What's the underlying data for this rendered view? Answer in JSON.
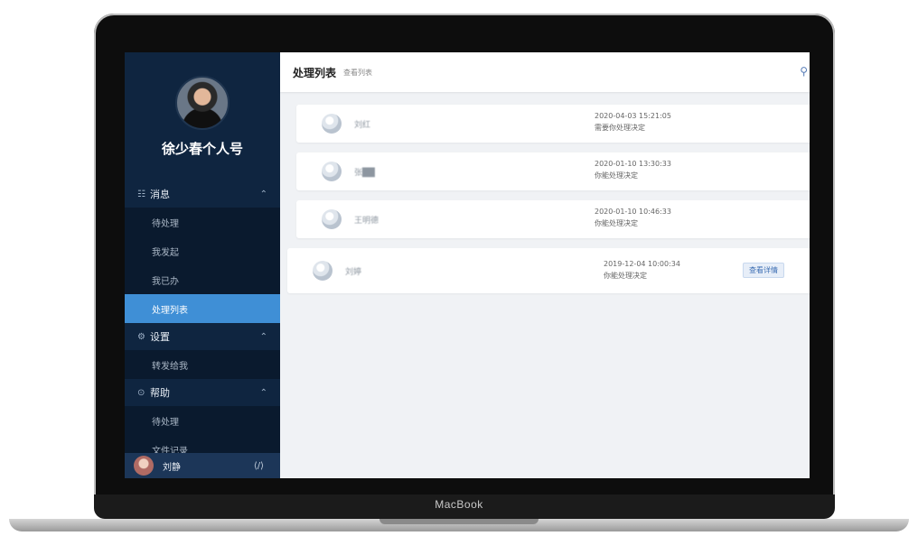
{
  "device": {
    "brand_label": "MacBook"
  },
  "sidebar": {
    "profile_name": "徐少春个人号",
    "groups": [
      {
        "icon": "☷",
        "label": "消息",
        "items": [
          {
            "label": "待处理",
            "active": false
          },
          {
            "label": "我发起",
            "active": false
          },
          {
            "label": "我已办",
            "active": false
          },
          {
            "label": "处理列表",
            "active": true
          }
        ]
      },
      {
        "icon": "⚙",
        "label": "设置",
        "items": [
          {
            "label": "转发给我"
          }
        ]
      },
      {
        "icon": "⊙",
        "label": "帮助",
        "items": [
          {
            "label": "待处理"
          },
          {
            "label": "文件记录"
          }
        ]
      }
    ],
    "user": {
      "name": "刘静",
      "arrow": "⟨/⟩"
    }
  },
  "main": {
    "title": "处理列表",
    "subtitle": "查看列表",
    "topbar_icon": "⚲",
    "items": [
      {
        "name": "刘红",
        "time": "2020-04-03 15:21:05",
        "status": "需要你处理决定"
      },
      {
        "name": "张██",
        "time": "2020-01-10 13:30:33",
        "status": "你能处理决定"
      },
      {
        "name": "王明德",
        "time": "2020-01-10 10:46:33",
        "status": "你能处理决定"
      },
      {
        "name": "刘婷",
        "time": "2019-12-04 10:00:34",
        "status": "你能处理决定",
        "action": "查看详情"
      }
    ]
  },
  "colors": {
    "sidebar_bg": "#0f2540",
    "active_item": "#3f8fd6",
    "content_bg": "#f0f2f5"
  }
}
